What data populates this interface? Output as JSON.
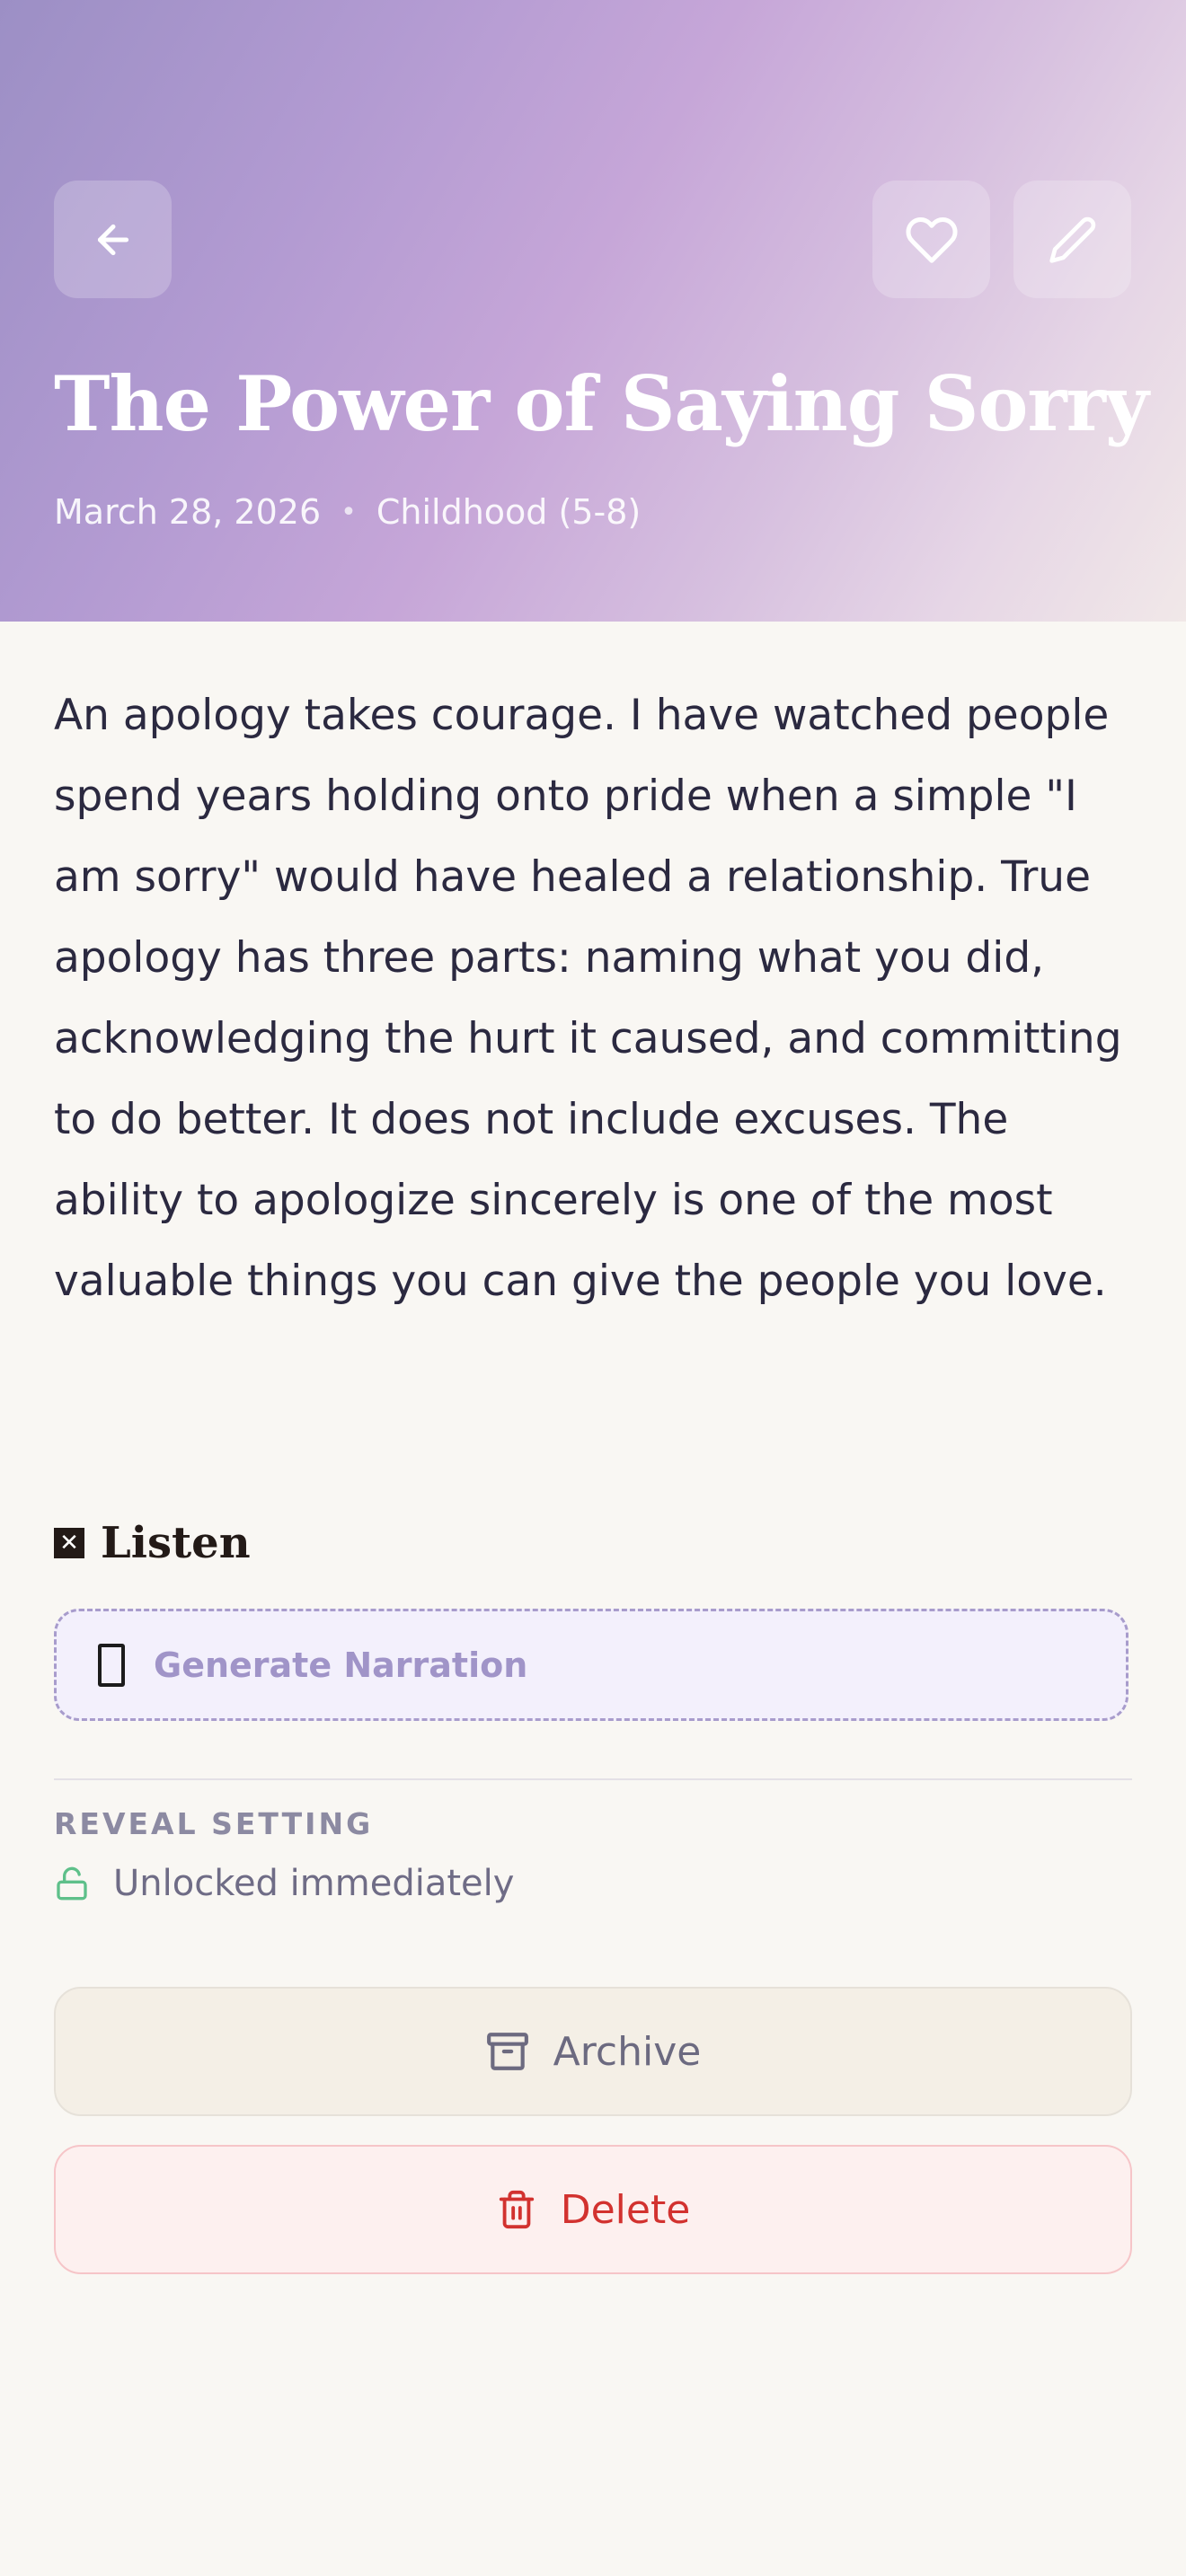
{
  "header": {
    "back_icon": "arrow-left-icon",
    "favorite_icon": "heart-icon",
    "edit_icon": "pencil-icon",
    "title": "The Power of Saying Sorry",
    "date": "March 28, 2026",
    "separator": "•",
    "category": "Childhood (5-8)"
  },
  "entry": {
    "body": "An apology takes courage. I have watched people spend years holding onto pride when a simple \"I am sorry\" would have healed a relationship. True apology has three parts: naming what you did, acknowledging the hurt it caused, and committing to do better. It does not include excuses. The ability to apologize sincerely is one of the most valuable things you can give the people you love."
  },
  "listen": {
    "heading_glyph": "✕",
    "heading": "Listen",
    "generate_label": "Generate Narration"
  },
  "reveal": {
    "heading": "REVEAL SETTING",
    "status": "Unlocked immediately",
    "status_icon": "unlock-icon"
  },
  "actions": {
    "archive_label": "Archive",
    "archive_icon": "archive-icon",
    "delete_label": "Delete",
    "delete_icon": "trash-icon"
  },
  "colors": {
    "accent_purple": "#a094c8",
    "unlock_green": "#5ec08a",
    "danger_red": "#d2322f",
    "text_dark": "#2b2940"
  }
}
